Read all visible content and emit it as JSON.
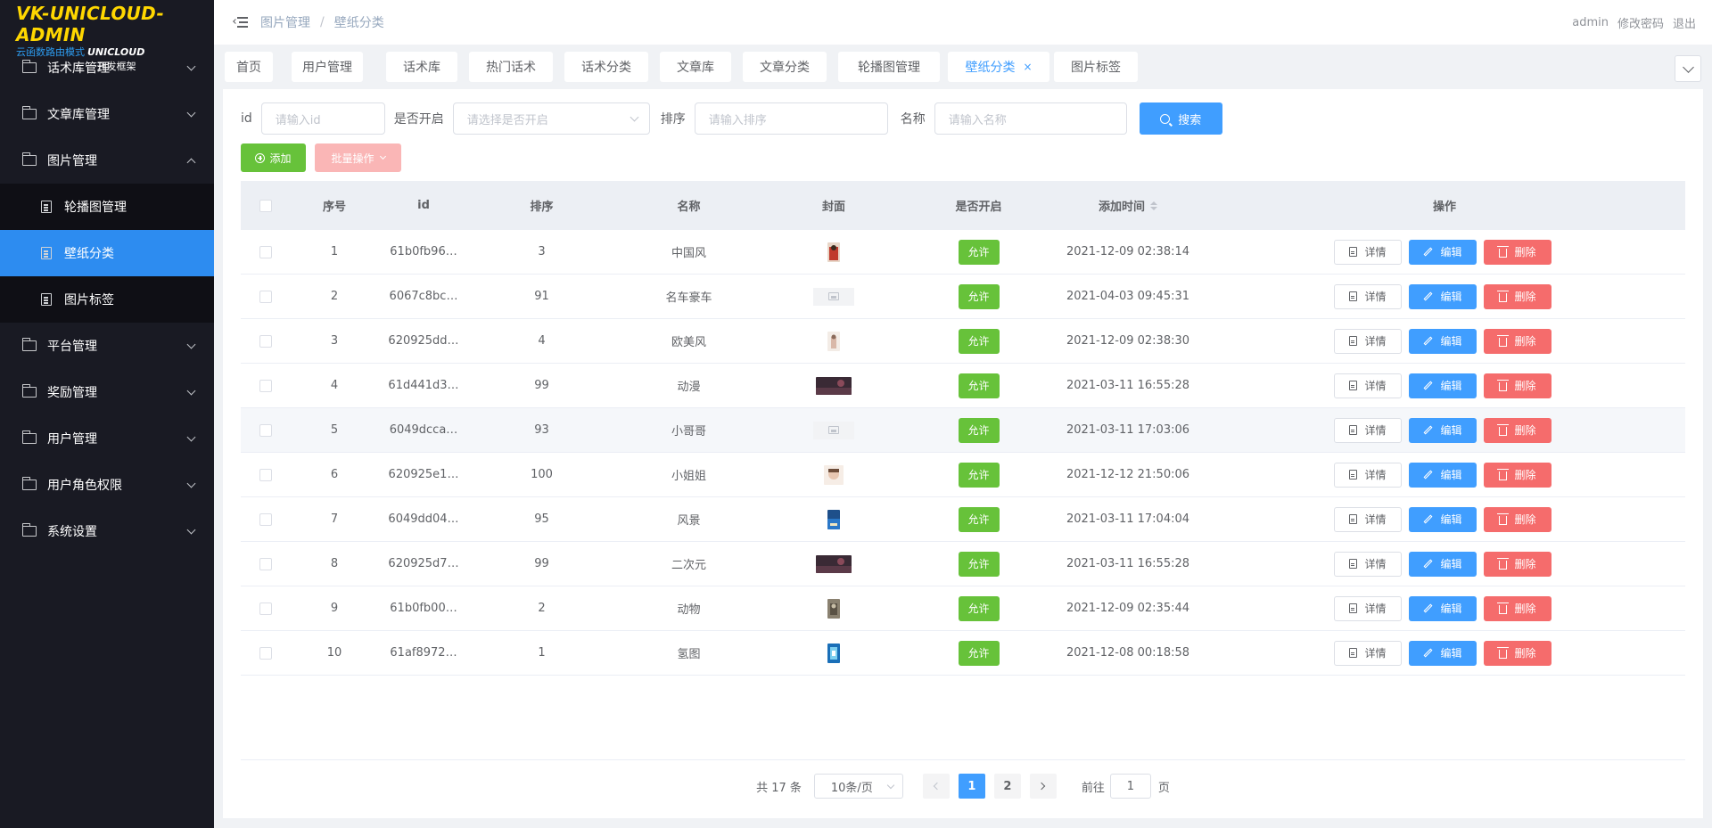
{
  "logo": {
    "title": "VK-UNICLOUD-ADMIN",
    "sub_a": "云函数路由模式",
    "sub_b": "UNICLOUD",
    "sub_c": "开发框架"
  },
  "sidebar": {
    "menu_top": [
      {
        "label": "话术库管理"
      },
      {
        "label": "文章库管理"
      },
      {
        "label": "图片管理"
      }
    ],
    "submenu": [
      {
        "label": "轮播图管理",
        "active": false
      },
      {
        "label": "壁纸分类",
        "active": true
      },
      {
        "label": "图片标签",
        "active": false
      }
    ],
    "menu_bottom": [
      {
        "label": "平台管理"
      },
      {
        "label": "奖励管理"
      },
      {
        "label": "用户管理"
      },
      {
        "label": "用户角色权限"
      },
      {
        "label": "系统设置"
      }
    ]
  },
  "header": {
    "breadcrumb": [
      "图片管理",
      "壁纸分类"
    ],
    "breadcrumb_sep": "/",
    "user": "admin",
    "change_password": "修改密码",
    "logout": "退出"
  },
  "tags": [
    {
      "label": "首页",
      "active": false
    },
    {
      "label": "用户管理",
      "active": false
    },
    {
      "label": "话术库",
      "active": false
    },
    {
      "label": "热门话术",
      "active": false
    },
    {
      "label": "话术分类",
      "active": false
    },
    {
      "label": "文章库",
      "active": false
    },
    {
      "label": "文章分类",
      "active": false
    },
    {
      "label": "轮播图管理",
      "active": false
    },
    {
      "label": "壁纸分类",
      "active": true,
      "close": "×"
    },
    {
      "label": "图片标签",
      "active": false
    }
  ],
  "search": {
    "id_label": "id",
    "id_placeholder": "请输入id",
    "open_label": "是否开启",
    "open_placeholder": "请选择是否开启",
    "sort_label": "排序",
    "sort_placeholder": "请输入排序",
    "name_label": "名称",
    "name_placeholder": "请输入名称",
    "search_button": "搜索"
  },
  "actions": {
    "add": "添加",
    "batch": "批量操作"
  },
  "table": {
    "columns": [
      "序号",
      "id",
      "排序",
      "名称",
      "封面",
      "是否开启",
      "添加时间",
      "操作"
    ],
    "status_label": "允许",
    "btn_detail": "详情",
    "btn_edit": "编辑",
    "btn_delete": "删除",
    "rows": [
      {
        "no": "1",
        "id": "61b0fb96…",
        "sort": "3",
        "name": "中国风",
        "open": "允许",
        "time": "2021-12-09 02:38:14",
        "cover": "portrait-red"
      },
      {
        "no": "2",
        "id": "6067c8bc…",
        "sort": "91",
        "name": "名车豪车",
        "open": "允许",
        "time": "2021-04-03 09:45:31",
        "cover": "placeholder"
      },
      {
        "no": "3",
        "id": "620925dd…",
        "sort": "4",
        "name": "欧美风",
        "open": "允许",
        "time": "2021-12-09 02:38:30",
        "cover": "portrait-light"
      },
      {
        "no": "4",
        "id": "61d441d3…",
        "sort": "99",
        "name": "动漫",
        "open": "允许",
        "time": "2021-03-11 16:55:28",
        "cover": "landscape-dark"
      },
      {
        "no": "5",
        "id": "6049dcca…",
        "sort": "93",
        "name": "小哥哥",
        "open": "允许",
        "time": "2021-03-11 17:03:06",
        "cover": "placeholder"
      },
      {
        "no": "6",
        "id": "620925e1…",
        "sort": "100",
        "name": "小姐姐",
        "open": "允许",
        "time": "2021-12-12 21:50:06",
        "cover": "square-light"
      },
      {
        "no": "7",
        "id": "6049dd04…",
        "sort": "95",
        "name": "风景",
        "open": "允许",
        "time": "2021-03-11 17:04:04",
        "cover": "portrait-blue"
      },
      {
        "no": "8",
        "id": "620925d7…",
        "sort": "99",
        "name": "二次元",
        "open": "允许",
        "time": "2021-03-11 16:55:28",
        "cover": "landscape-dark"
      },
      {
        "no": "9",
        "id": "61b0fb00…",
        "sort": "2",
        "name": "动物",
        "open": "允许",
        "time": "2021-12-09 02:35:44",
        "cover": "portrait-gray"
      },
      {
        "no": "10",
        "id": "61af8972…",
        "sort": "1",
        "name": "氢图",
        "open": "允许",
        "time": "2021-12-08 00:18:58",
        "cover": "portrait-cyan"
      }
    ]
  },
  "pagination": {
    "total": "共 17 条",
    "page_size": "10条/页",
    "pages": [
      "1",
      "2"
    ],
    "current": "1",
    "goto_prefix": "前往",
    "goto_value": "1",
    "goto_suffix": "页"
  },
  "colors": {
    "primary": "#409eff",
    "success": "#67c23a",
    "danger": "#f56c6c",
    "sidebar": "#191a23",
    "logo": "#ffd700"
  }
}
